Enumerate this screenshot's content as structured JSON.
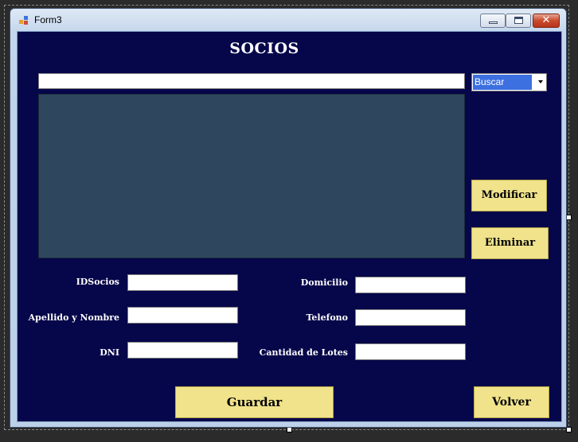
{
  "window": {
    "title": "Form3",
    "controls": {
      "minimize_icon": "minimize-icon",
      "maximize_icon": "maximize-icon",
      "close_icon": "close-icon",
      "close_glyph": "✕"
    }
  },
  "header": {
    "title": "SOCIOS"
  },
  "search": {
    "value": "",
    "select_selected": "Buscar"
  },
  "actions": {
    "modify_label": "Modificar",
    "delete_label": "Eliminar",
    "save_label": "Guardar",
    "back_label": "Volver"
  },
  "form": {
    "id_label": "IDSocios",
    "id_value": "",
    "name_label": "Apellido y Nombre",
    "name_value": "",
    "dni_label": "DNI",
    "dni_value": "",
    "address_label": "Domicilio",
    "address_value": "",
    "phone_label": "Telefono",
    "phone_value": "",
    "lots_label": "Cantidad de Lotes",
    "lots_value": ""
  },
  "colors": {
    "client_background": "#06064a",
    "grid_background": "#2e475e",
    "button_background": "#f0e38b",
    "select_highlight": "#3c6fe0"
  }
}
